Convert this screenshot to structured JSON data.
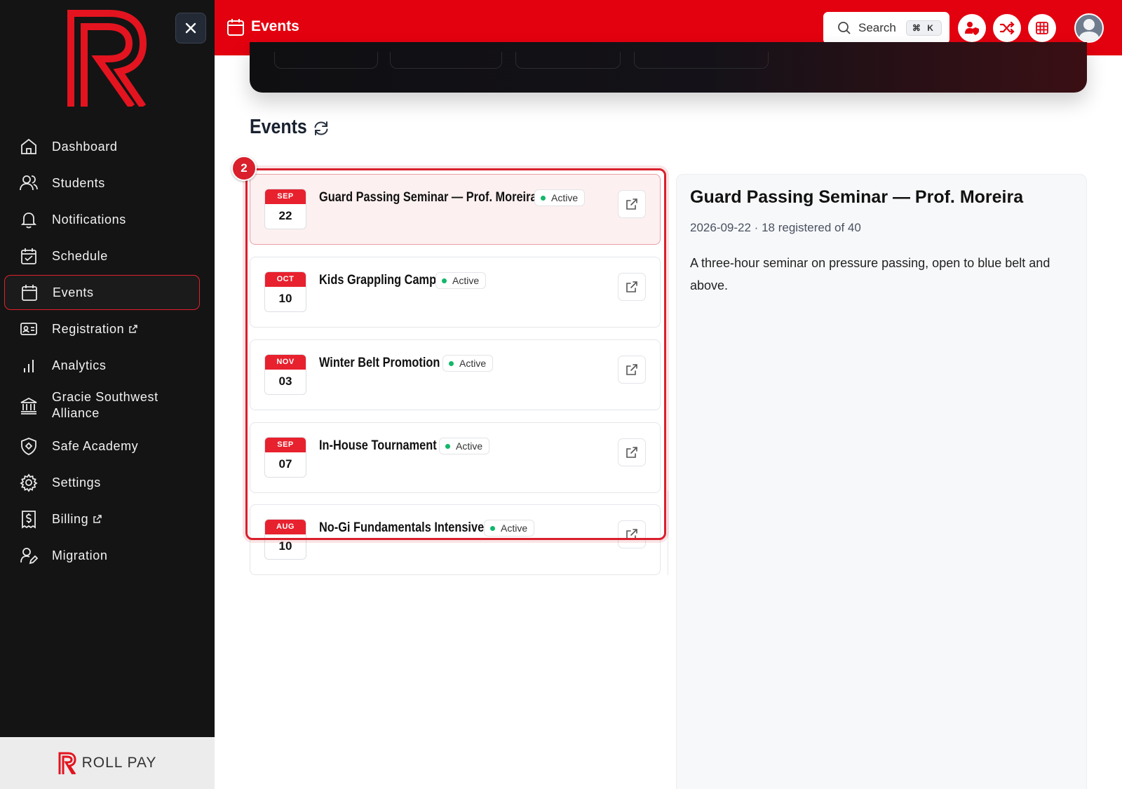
{
  "sidebar": {
    "brand_mark": "R",
    "close_icon": "close-icon",
    "items": [
      {
        "label": "Dashboard",
        "icon": "home-icon"
      },
      {
        "label": "Students",
        "icon": "users-icon"
      },
      {
        "label": "Notifications",
        "icon": "bell-icon"
      },
      {
        "label": "Schedule",
        "icon": "calendar-check-icon"
      },
      {
        "label": "Events",
        "icon": "calendar-icon",
        "active": true
      },
      {
        "label": "Registration",
        "icon": "id-card-icon",
        "external": true
      },
      {
        "label": "Analytics",
        "icon": "bar-chart-icon"
      },
      {
        "label": "Gracie Southwest Alliance",
        "icon": "bank-icon"
      },
      {
        "label": "Safe Academy",
        "icon": "shield-icon"
      },
      {
        "label": "Settings",
        "icon": "gear-icon"
      },
      {
        "label": "Billing",
        "icon": "receipt-dollar-icon",
        "external": true
      },
      {
        "label": "Migration",
        "icon": "user-edit-icon"
      }
    ],
    "footer": {
      "brand_text": "ROLL PAY"
    }
  },
  "header": {
    "title": "Events",
    "search": {
      "label": "Search",
      "shortcut": "⌘ K"
    },
    "actions": [
      "user-shield-icon",
      "shuffle-icon",
      "grid-icon"
    ],
    "avatar": "avatar-icon"
  },
  "main": {
    "section_title": "Events",
    "marker": "2",
    "events": [
      {
        "month": "SEP",
        "day": "22",
        "name": "Guard Passing Seminar — Prof. Moreira",
        "status": "Active"
      },
      {
        "month": "OCT",
        "day": "10",
        "name": "Kids Grappling Camp",
        "status": "Active"
      },
      {
        "month": "NOV",
        "day": "03",
        "name": "Winter Belt Promotion",
        "status": "Active"
      },
      {
        "month": "SEP",
        "day": "07",
        "name": "In-House Tournament",
        "status": "Active"
      },
      {
        "month": "AUG",
        "day": "10",
        "name": "No-Gi Fundamentals Intensive",
        "status": "Active"
      }
    ],
    "detail": {
      "title": "Guard Passing Seminar — Prof. Moreira",
      "meta": "2026-09-22 · 18 registered of 40",
      "description": "A three-hour seminar on pressure passing, open to blue belt and above."
    }
  },
  "colors": {
    "brand": "#e3000f",
    "sidebar": "#141414",
    "status_active": "#12b76a"
  }
}
